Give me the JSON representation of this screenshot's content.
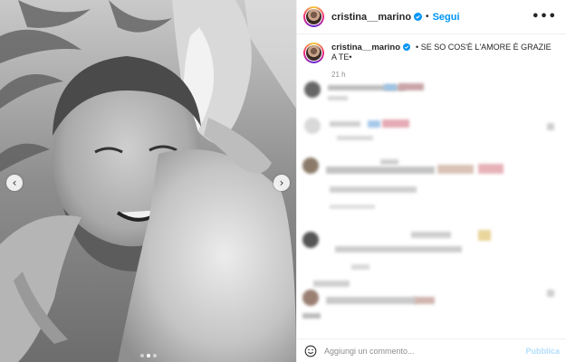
{
  "header": {
    "username": "cristina__marino",
    "separator": "•",
    "follow_label": "Segui",
    "more_icon": "more-horizontal-icon"
  },
  "caption": {
    "username": "cristina__marino",
    "text": "• SE SO COS'È L'AMORE È GRAZIE A TE•",
    "time": "21 h"
  },
  "comment_box": {
    "placeholder": "Aggiungi un commento...",
    "publish_label": "Pubblica",
    "emoji_icon": "emoji-icon"
  },
  "media": {
    "prev_icon": "chevron-left-icon",
    "next_icon": "chevron-right-icon",
    "prev_glyph": "‹",
    "next_glyph": "›",
    "slides_total": 3,
    "active_slide": 2
  },
  "colors": {
    "follow": "#0095f6",
    "publish_disabled": "#b2dffc",
    "muted": "#8e8e8e",
    "text": "#262626"
  }
}
